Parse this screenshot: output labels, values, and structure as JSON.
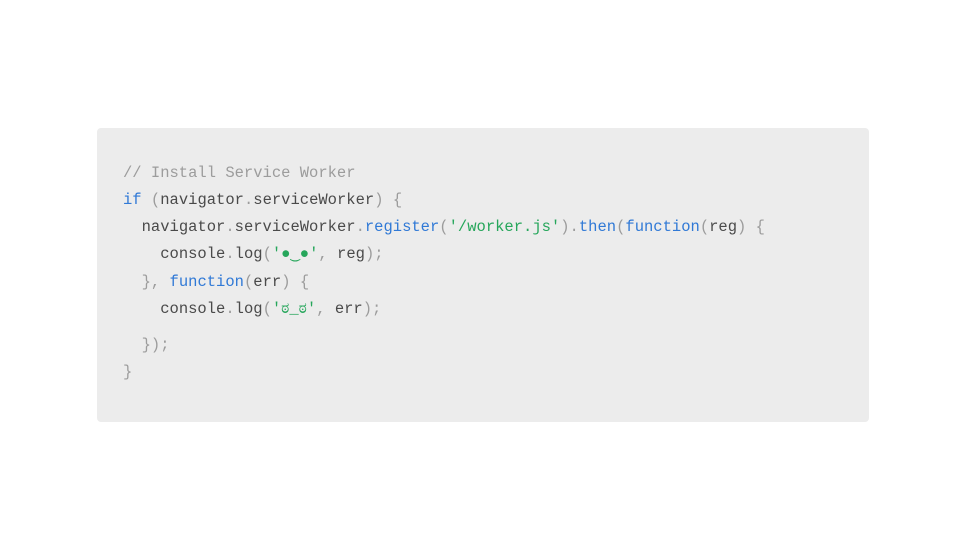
{
  "code": {
    "l1_comment": "// Install Service Worker",
    "l2": {
      "kw_if": "if",
      "space1": " ",
      "lparen": "(",
      "navigator": "navigator",
      "dot1": ".",
      "serviceWorker": "serviceWorker",
      "rparen": ")",
      "space2": " ",
      "lbrace": "{"
    },
    "l3": {
      "indent": "  ",
      "navigator": "navigator",
      "dot1": ".",
      "serviceWorker": "serviceWorker",
      "dot2": ".",
      "register": "register",
      "lparen1": "(",
      "url": "'/worker.js'",
      "rparen1": ")",
      "dot3": ".",
      "then": "then",
      "lparen2": "(",
      "kw_function": "function",
      "lparen3": "(",
      "reg": "reg",
      "rparen3": ")",
      "space": " ",
      "lbrace": "{"
    },
    "l4": {
      "indent": "    ",
      "console": "console",
      "dot": ".",
      "log": "log",
      "lparen": "(",
      "str": "'●‿●'",
      "comma": ",",
      "space": " ",
      "reg": "reg",
      "rparen": ")",
      "semi": ";"
    },
    "l5": {
      "indent": "  ",
      "rbrace": "}",
      "comma": ",",
      "space": " ",
      "kw_function": "function",
      "lparen": "(",
      "err": "err",
      "rparen": ")",
      "space2": " ",
      "lbrace": "{"
    },
    "l6": {
      "indent": "    ",
      "console": "console",
      "dot": ".",
      "log": "log",
      "lparen": "(",
      "str": "'ಠ_ಠ'",
      "comma": ",",
      "space": " ",
      "err": "err",
      "rparen": ")",
      "semi": ";"
    },
    "l7": {
      "indent": "  ",
      "rbrace": "}",
      "rparen": ")",
      "semi": ";"
    },
    "l8": {
      "rbrace": "}"
    }
  }
}
